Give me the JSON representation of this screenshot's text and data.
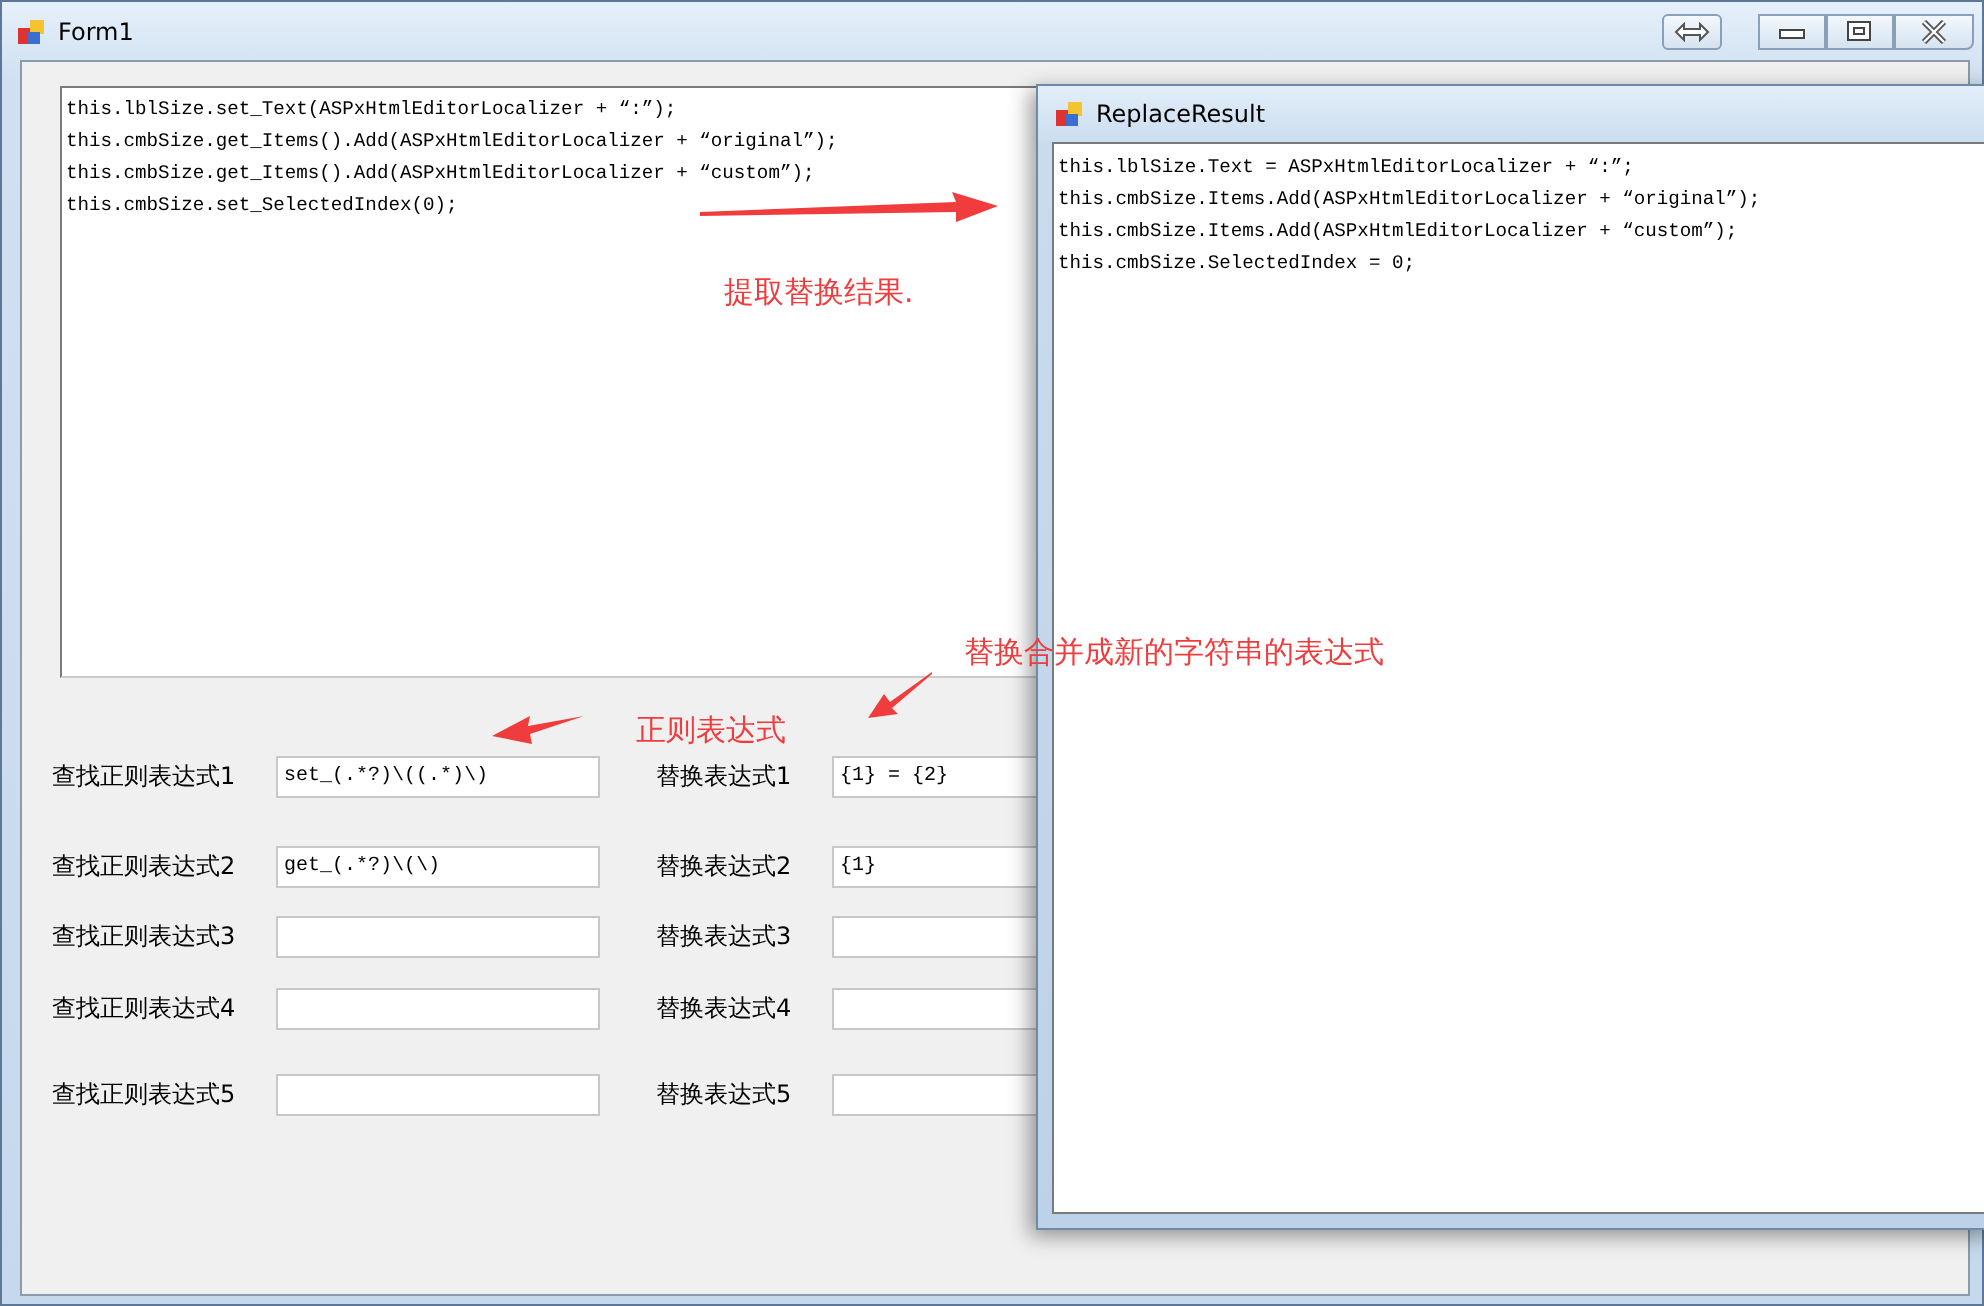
{
  "form1": {
    "title": "Form1",
    "code_lines": [
      "this.lblSize.set_Text(ASPxHtmlEditorLocalizer + “:”);",
      "this.cmbSize.get_Items().Add(ASPxHtmlEditorLocalizer + “original”);",
      "this.cmbSize.get_Items().Add(ASPxHtmlEditorLocalizer + “custom”);",
      "this.cmbSize.set_SelectedIndex(0);"
    ],
    "rows": [
      {
        "find_label": "查找正则表达式1",
        "find_value": "set_(.*?)\\((.*)\\)",
        "replace_label": "替换表达式1",
        "replace_value": "{1} = {2}"
      },
      {
        "find_label": "查找正则表达式2",
        "find_value": "get_(.*?)\\(\\)",
        "replace_label": "替换表达式2",
        "replace_value": "{1}"
      },
      {
        "find_label": "查找正则表达式3",
        "replace_label": "替换表达式3"
      },
      {
        "find_label": "查找正则表达式4",
        "replace_label": "替换表达式4"
      },
      {
        "find_label": "查找正则表达式5",
        "replace_label": "替换表达式5"
      }
    ]
  },
  "replace_result": {
    "title": "ReplaceResult",
    "lines": [
      "this.lblSize.Text = ASPxHtmlEditorLocalizer + “:”;",
      "this.cmbSize.Items.Add(ASPxHtmlEditorLocalizer + “original”);",
      "this.cmbSize.Items.Add(ASPxHtmlEditorLocalizer + “custom”);",
      "this.cmbSize.SelectedIndex = 0;"
    ]
  },
  "annotations": [
    "提取替换结果.",
    "正则表达式",
    "替换合并成新的字符串的表达式"
  ]
}
